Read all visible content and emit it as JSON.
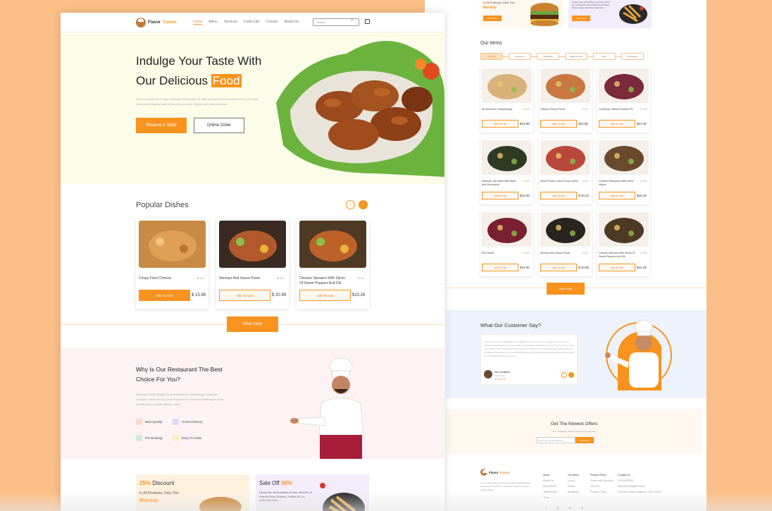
{
  "nav": {
    "logo_first": "Flavor",
    "logo_second": "Fusion",
    "links": [
      "Home",
      "Menu",
      "Services",
      "Food Cart",
      "Contact",
      "About Us"
    ],
    "search_placeholder": "Search"
  },
  "hero": {
    "title_line1": "Indulge Your Taste With",
    "title_line2_prefix": "Our Delicious",
    "title_highlight": "Food",
    "paragraph": "Semi Lio lacus nisi a ungu montqua mihen odiki. Ex nulla solvisus ult morbi suada est sur. Ex diam rhonc voluti magna nulla facilisi a ertio vs am. Sagittis vue pharetra amet.",
    "reserve_label": "Reserve a Table",
    "order_label": "Online Order"
  },
  "popular": {
    "title": "Popular Dishes",
    "items": [
      {
        "name": "Crispy Fried Chicken",
        "rating": "5.0",
        "button": "Add To Cart",
        "price": "$ 15.99"
      },
      {
        "name": "Shrimps And Sauce Pasta",
        "rating": "5.0",
        "button": "Add To Cart",
        "price": "$ 20.99"
      },
      {
        "name": "Chicken Skewers With Slices Of Sweet Peppers And Dill",
        "rating": "5.0",
        "button": "Add To Cart",
        "price": "$10.26"
      }
    ],
    "view_more": "View more"
  },
  "why": {
    "title": "Why Is Our Restaurant The Best Choice For You?",
    "paragraph": "Enim Ipsi Id Est Sapien Ex Ut Volutpat Ut. Pellentesque Vulputate Volutpat Commodo Est. Cras Pulvinar Orci Pharetra Scelerisque Amet Condimentum Quam Ultrices. Vitae",
    "features": [
      "Best Quality",
      "Home Delivery",
      "Pre Booking",
      "Easy To Order"
    ]
  },
  "deals": [
    {
      "percent": "25%",
      "title": "Discount",
      "subtitle": "In All Products, Only This",
      "highlight": "Monday"
    },
    {
      "title": "Sale Off",
      "percent": "30%",
      "subtitle": "Fuscar Sce Vertif Ultricies In Felis, Ulli At Eu Ut Pharetra Risus Pharetra. Porttitor Mi Cur Quam Sed Nunc"
    }
  ],
  "right_promo": [
    {
      "line": "In All Products, Only This",
      "highlight": "Monday",
      "button": "Order Now"
    },
    {
      "line": "Fuscar Sce Vertif Ultricies In Felis, Ulli At Eu Ut Pharetra Risus Pharetra. Porttitor Mi Cur Quam Sed Nunc Sed Nunc",
      "button": "Order Now"
    }
  ],
  "items": {
    "title": "Our Items",
    "filters": [
      "All Items",
      "Japanese",
      "Vegetable",
      "Regional Fusi",
      "Rice",
      "Beverages"
    ],
    "cards": [
      {
        "name": "All American Cheeseburger",
        "rating": "5.0",
        "price": "$15.99"
      },
      {
        "name": "Classic Cheese Pizza",
        "rating": "5.0",
        "price": "$10.88"
      },
      {
        "name": "Cranberry Classic Chicken Pie",
        "rating": "5.0",
        "price": "$14.26"
      },
      {
        "name": "Rainbow Job Salad With Basil And Mozzarella",
        "rating": "5.0",
        "price": "$15.99"
      },
      {
        "name": "Sweet Potato Carrot Soup Combo",
        "rating": "5.0",
        "price": "$ 30.22"
      },
      {
        "name": "Chicken Shawarma With Extra Mayos",
        "rating": "5.0",
        "price": "$16.26"
      },
      {
        "name": "Red Velvet",
        "rating": "5.0",
        "price": "$10.00"
      },
      {
        "name": "Shrimps And Sauce Pasta",
        "rating": "5.0",
        "price": "$ 20.99"
      },
      {
        "name": "Chicken Skewers With Slices Of Sweet Peppers And Dill",
        "rating": "5.0",
        "price": "$10.26"
      }
    ],
    "button": "Add To Cart",
    "view_more": "View more"
  },
  "customer": {
    "title": "What Our Customer Say?",
    "quote": "Tempor Incididunt Ut Aliqua Id Sed Mi Massa Lorem Fusce Risus. Ultrices Tincidunt Ut Nisl Aliquam Massa Magna Ut Aenean Mattis. Suspendisse Imperdiet Ut Lacus Ut Felis Sit Ac In Nisl Urna Tortor Lectus Tristique Vel Mollis Pharetra Tincidunt. Nunc Erat Nisi Vitae Lorem Pharetra Consequat Orci Risus Sed Ut Gravida Fermentum Ut Et Erat Nisi Nunc Dignissim Vel Tortor Nisl. Ut Leo Blandit Et Placenta Massa.",
    "author": "Alex Jonathon",
    "role": "Food Lover",
    "stars": "★★★★★"
  },
  "offers": {
    "title": "Get The Newest Offers",
    "subtitle": "Join newsletter With All Latest Announcement",
    "input_placeholder": "Enter Your Email Address",
    "button": "Subscribe"
  },
  "footer": {
    "about_title": "About",
    "about_text": "Lorem ipsum dolor sit amet consectetur adipiscing elit sed do eiusmod tempor incididunt ut labore et dolore magna aliqua.",
    "cols": [
      {
        "title": "About",
        "links": [
          "About Us",
          "Menu Items",
          "Testimonials",
          "Team"
        ]
      },
      {
        "title": "Our Menu",
        "links": [
          "Lunch",
          "Dinner",
          "Breakfast"
        ]
      },
      {
        "title": "Privacy Policy",
        "links": [
          "Terms and Condition",
          "Security",
          "Privacy Policy"
        ]
      },
      {
        "title": "Contact Us",
        "links": [
          "+1234567890",
          "flavorfusion@gmail.com",
          "123 Main Street, Anytown, USA 12345"
        ]
      }
    ]
  },
  "colors": {
    "accent": "#f7931e",
    "background": "#fbbf87",
    "hero_bg": "#fbfde9"
  }
}
